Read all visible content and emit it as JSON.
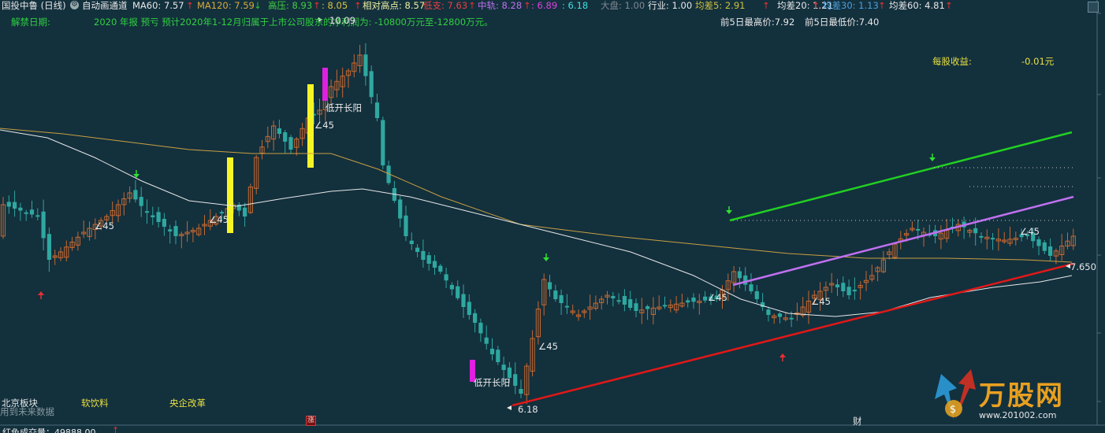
{
  "title": {
    "stock": "国投中鲁 (日线)",
    "draw_toggle": "自动画通道"
  },
  "indicators": {
    "ma60": "MA60: 7.57",
    "ma120": "MA120: 7.59",
    "high_press": "高压: 8.93",
    "high_press2": ": 8.05",
    "rel_high": "相对高点: 8.57",
    "low_support": "低支: 7.63",
    "mid_track": "中轨: 8.28",
    "val_a": ": 6.89",
    "val_b": ": 6.18",
    "market": "大盘: 1.00",
    "industry": "行业: 1.00",
    "avg5": "均差5: 2.91",
    "avg20": "均差20: 1.21",
    "avg30": "均差30: 1.13",
    "avg60": "均差60: 4.81"
  },
  "info_row": {
    "unlock_date": "解禁日期:",
    "report": "2020 年报 预亏 预计2020年1-12月归属于上市公司股东的净利润为: -10800万元至-12800万元。",
    "prev5_high": "前5日最高价:7.92",
    "prev5_low": "前5日最低价:7.40"
  },
  "eps": {
    "label": "每股收益:",
    "value": "-0.01元"
  },
  "chart_labels": {
    "peak": "10.09",
    "bottom": "6.18",
    "last": "7.650",
    "gap_up_1": "低开长阳",
    "gap_up_2": "低开长阳",
    "angle": "∠45"
  },
  "sectors": [
    "北京板块",
    "软饮料",
    "央企改革"
  ],
  "bottom_note": "用到未来数据",
  "flags": {
    "zhang": "涨",
    "cai": "财"
  },
  "volume_label": "红色成交量：49888.00",
  "watermark": {
    "brand": "万股网",
    "url": "www.201002.com"
  },
  "colors": {
    "background": "#13303d",
    "up_candle": "#c8682f",
    "down_candle": "#2ea8a0",
    "ma60": "#e8e8e8",
    "ma120": "#c8a040",
    "upper_channel": "#22d022",
    "mid_channel": "#c070f0",
    "lower_channel": "#e01818",
    "highlight_yellow": "#f5f526",
    "highlight_magenta": "#e020e0"
  }
}
